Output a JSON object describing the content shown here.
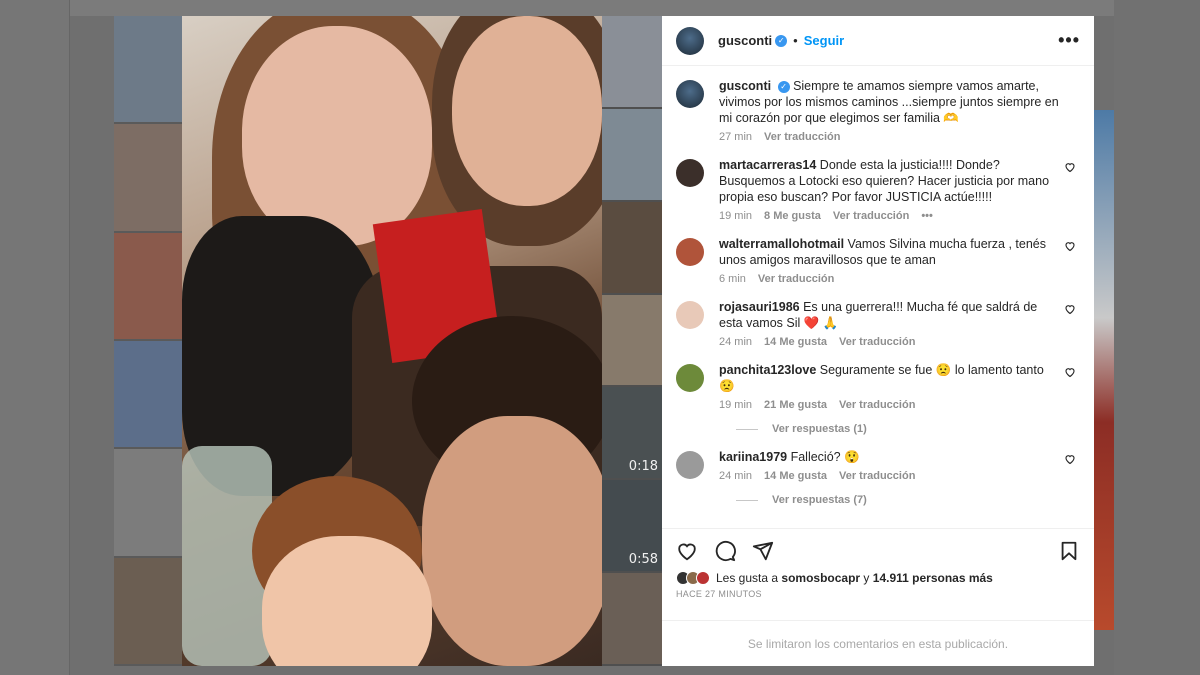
{
  "post": {
    "username": "gusconti",
    "follow_label": "Seguir",
    "separator": "•",
    "caption": "Siempre te amamos siempre vamos amarte, vivimos por los mismos caminos ...siempre juntos siempre en mi corazón por que elegimos ser familia 🫶",
    "caption_time": "27 min",
    "see_translation": "Ver traducción"
  },
  "comments": [
    {
      "user": "martacarreras14",
      "text": "Donde esta la justicia!!!! Donde? Busquemos a Lotocki eso quieren? Hacer justicia por mano propia eso buscan? Por favor JUSTICIA actúe!!!!!",
      "time": "19 min",
      "likes": "8 Me gusta",
      "translate": "Ver traducción",
      "more": "•••",
      "avatar_color": "#3b2f2a"
    },
    {
      "user": "walterramallohotmail",
      "text": "Vamos Silvina mucha fuerza , tenés unos amigos maravillosos que te aman",
      "time": "6 min",
      "likes": "",
      "translate": "Ver traducción",
      "avatar_color": "#b0543a"
    },
    {
      "user": "rojasauri1986",
      "text": "Es una guerrera!!! Mucha fé que saldrá de esta vamos Sil ❤️ 🙏",
      "time": "24 min",
      "likes": "14 Me gusta",
      "translate": "Ver traducción",
      "avatar_color": "#e8c9b8"
    },
    {
      "user": "panchita123love",
      "text": "Seguramente se fue 😟 lo lamento tanto 😟",
      "time": "19 min",
      "likes": "21 Me gusta",
      "translate": "Ver traducción",
      "avatar_color": "#6d8a3a"
    },
    {
      "user": "kariina1979",
      "text": "Falleció? 😲",
      "time": "24 min",
      "likes": "14 Me gusta",
      "translate": "Ver traducción",
      "avatar_color": "#9a9a9a"
    }
  ],
  "replies": [
    "Ver respuestas (1)",
    "Ver respuestas (7)"
  ],
  "likes_summary": {
    "prefix": "Les gusta a",
    "user": "somosbocapr",
    "joiner": "y",
    "rest": "14.911 personas más"
  },
  "posted_ago": "HACE 27 MINUTOS",
  "comments_limited": "Se limitaron los comentarios en esta publicación.",
  "video_times": [
    "0:18",
    "0:58"
  ],
  "colors": {
    "accent": "#0095f6",
    "text": "#262626",
    "muted": "#8e8e8e"
  }
}
